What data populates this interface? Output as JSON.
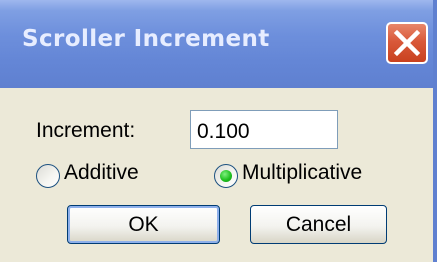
{
  "window": {
    "title": "Scroller Increment",
    "close_icon": "close-x-icon"
  },
  "form": {
    "increment_label": "Increment:",
    "increment_value": "0.100"
  },
  "mode": {
    "options": [
      {
        "label": "Additive",
        "selected": false
      },
      {
        "label": "Multiplicative",
        "selected": true
      }
    ]
  },
  "buttons": {
    "ok_label": "OK",
    "cancel_label": "Cancel"
  },
  "colors": {
    "titlebar": "#6d8fdc",
    "close_button": "#d9593a",
    "dialog_background": "#ece9d8",
    "radio_selected": "#21c121"
  }
}
